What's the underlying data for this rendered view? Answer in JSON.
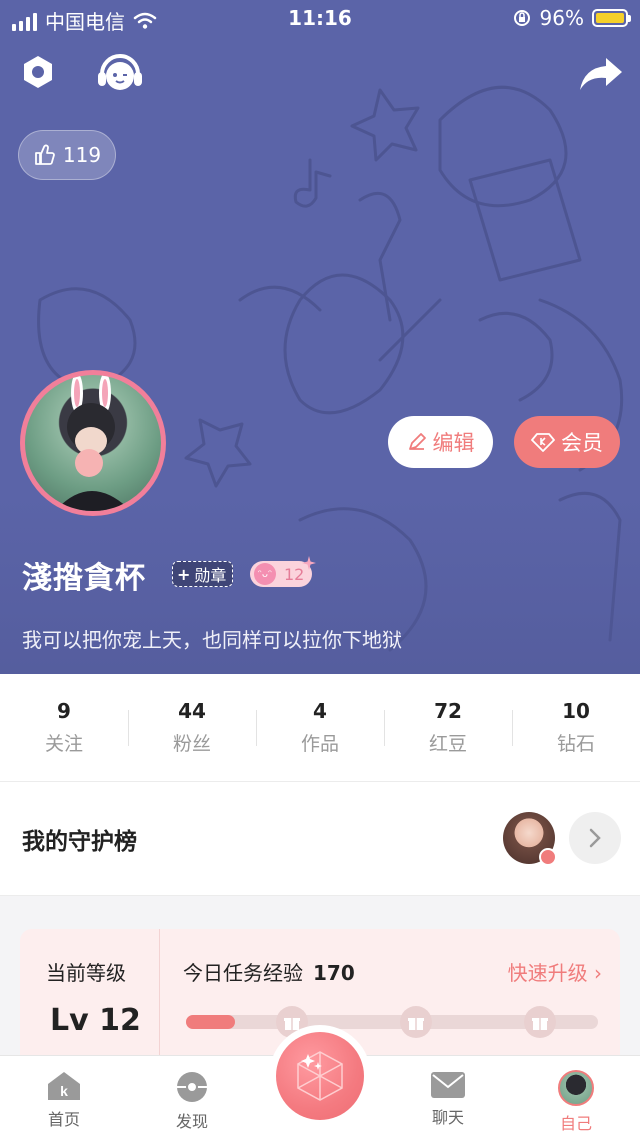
{
  "status_bar": {
    "carrier": "中国电信",
    "time": "11:16",
    "battery": "96%"
  },
  "header": {
    "settings_icon": "settings-icon",
    "companion_icon": "headphone-face-icon",
    "share_icon": "share-icon",
    "likes": "119"
  },
  "profile": {
    "name": "淺揝貪杯",
    "medal_label": "勋章",
    "level_badge": "12",
    "bio": "我可以把你宠上天，也同样可以拉你下地狱",
    "edit_label": "编辑",
    "vip_label": "会员"
  },
  "stats": [
    {
      "num": "9",
      "label": "关注"
    },
    {
      "num": "44",
      "label": "粉丝"
    },
    {
      "num": "4",
      "label": "作品"
    },
    {
      "num": "72",
      "label": "红豆"
    },
    {
      "num": "10",
      "label": "钻石"
    }
  ],
  "guard": {
    "title": "我的守护榜"
  },
  "level": {
    "caption": "当前等级",
    "value": "Lv 12",
    "task_label": "今日任务经验",
    "task_value": "170",
    "fast_upgrade": "快速升级",
    "progress": 0.12
  },
  "tabs": [
    {
      "label": "首页",
      "icon": "home-k-icon"
    },
    {
      "label": "发现",
      "icon": "discover-icon"
    },
    {
      "label": "聊天",
      "icon": "chat-icon"
    },
    {
      "label": "自己",
      "icon": "me-avatar-icon"
    }
  ],
  "colors": {
    "header_bg": "#5b64a8",
    "accent": "#f07c7c"
  }
}
